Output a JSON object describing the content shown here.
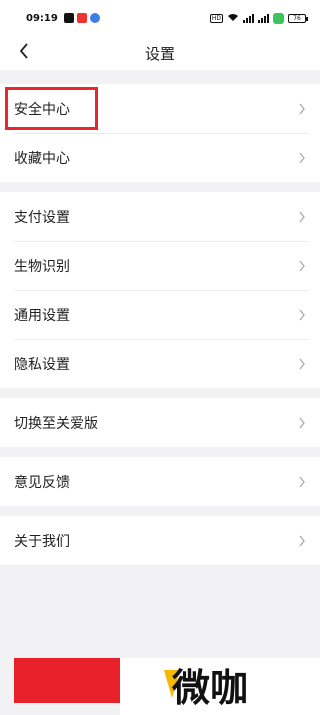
{
  "status_bar": {
    "time": "09:19",
    "battery": "76"
  },
  "nav": {
    "title": "设置"
  },
  "groups": [
    {
      "items": [
        {
          "label": "安全中心"
        },
        {
          "label": "收藏中心"
        }
      ]
    },
    {
      "items": [
        {
          "label": "支付设置"
        },
        {
          "label": "生物识别"
        },
        {
          "label": "通用设置"
        },
        {
          "label": "隐私设置"
        }
      ]
    },
    {
      "items": [
        {
          "label": "切换至关爱版"
        }
      ]
    },
    {
      "items": [
        {
          "label": "意见反馈"
        }
      ]
    },
    {
      "items": [
        {
          "label": "关于我们"
        }
      ]
    }
  ],
  "watermark": {
    "text": "微咖"
  },
  "colors": {
    "accent_red": "#e8202a",
    "highlight_border": "#e8282a",
    "background": "#f2f2f4"
  }
}
